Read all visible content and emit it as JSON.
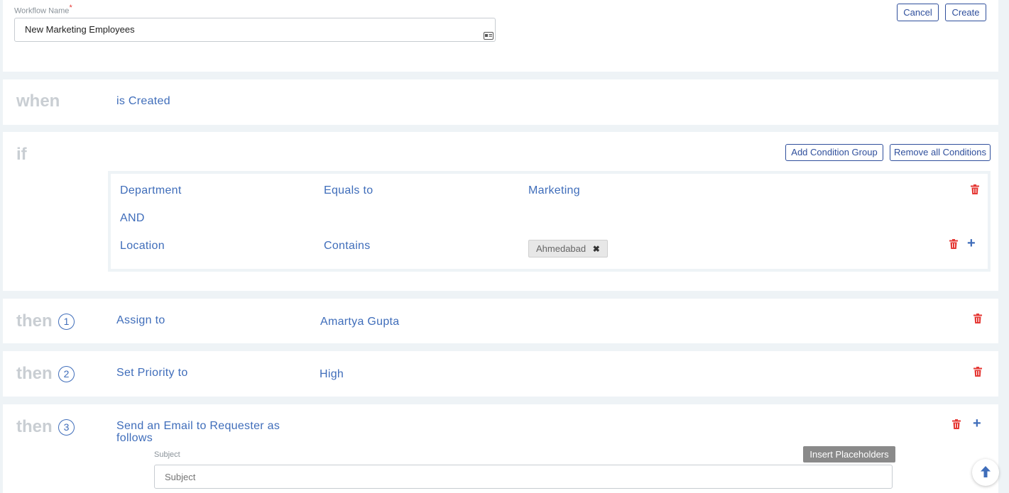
{
  "header": {
    "workflow_name_label": "Workflow Name",
    "required_mark": "*",
    "workflow_name_value": "New Marketing Employees",
    "cancel_label": "Cancel",
    "create_label": "Create"
  },
  "when": {
    "keyword": "when",
    "trigger": "is Created"
  },
  "if": {
    "keyword": "if",
    "add_group_label": "Add Condition Group",
    "remove_all_label": "Remove all Conditions",
    "conditions": [
      {
        "field": "Department",
        "operator": "Equals to",
        "value": "Marketing"
      },
      {
        "field": "Location",
        "operator": "Contains",
        "tag": "Ahmedabad"
      }
    ],
    "joiner": "AND"
  },
  "actions": [
    {
      "keyword": "then",
      "number": "1",
      "action": "Assign to",
      "value": "Amartya Gupta"
    },
    {
      "keyword": "then",
      "number": "2",
      "action": "Set Priority to",
      "value": "High"
    },
    {
      "keyword": "then",
      "number": "3",
      "action": "Send an Email to Requester as follows"
    }
  ],
  "email": {
    "subject_label": "Subject",
    "subject_placeholder": "Subject",
    "insert_placeholders_label": "Insert Placeholders"
  },
  "colors": {
    "accent": "#3f6dba",
    "danger": "#e53935",
    "keyword": "#c9ced3",
    "background": "#eef3f6"
  }
}
